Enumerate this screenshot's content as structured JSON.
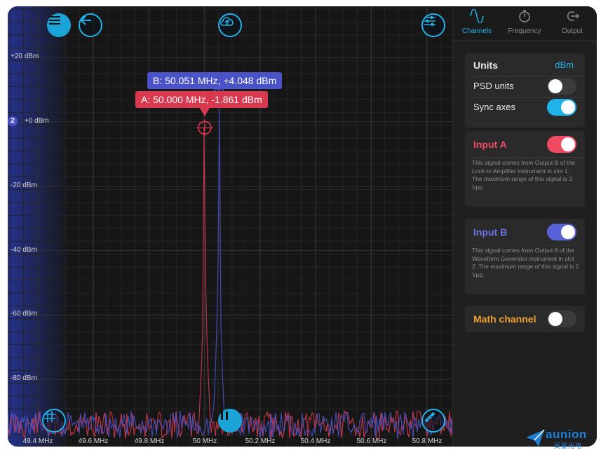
{
  "toolbar": {
    "menu_icon": "menu-icon",
    "back_icon": "arrow-left-icon",
    "upload_icon": "cloud-upload-icon",
    "settings_icon": "sliders-icon",
    "grid_icon": "grid-icon",
    "pause_icon": "pause-icon",
    "ruler_icon": "ruler-icon"
  },
  "markers": {
    "a": "A: 50.000 MHz, -1.861 dBm",
    "b": "B: 50.051 MHz, +4.048 dBm"
  },
  "channel_badge": "2",
  "colors": {
    "accent": "#1fb3ea",
    "channel_a": "#d9394f",
    "channel_b": "#4a54c8",
    "math": "#f0a030"
  },
  "chart_data": {
    "type": "line",
    "ylabel_unit": "dBm",
    "y_ticks": [
      "+20 dBm",
      "+0 dBm",
      "-20 dBm",
      "-40 dBm",
      "-60 dBm",
      "-80 dBm"
    ],
    "y_tick_values": [
      20,
      0,
      -20,
      -40,
      -60,
      -80
    ],
    "ylim": [
      -100,
      28
    ],
    "x_ticks": [
      "49.4 MHz",
      "49.6 MHz",
      "49.8 MHz",
      "50 MHz",
      "50.2 MHz",
      "50.4 MHz",
      "50.6 MHz",
      "50.8 MHz"
    ],
    "x_tick_values": [
      49.4,
      49.6,
      49.8,
      50.0,
      50.2,
      50.4,
      50.6,
      50.8
    ],
    "xlim": [
      49.25,
      50.95
    ],
    "grid": true,
    "series": [
      {
        "name": "Input A",
        "peak_x": 50.0,
        "peak_y": -1.861,
        "noise_floor": -92
      },
      {
        "name": "Input B",
        "peak_x": 50.051,
        "peak_y": 4.048,
        "noise_floor": -92
      }
    ]
  },
  "panel": {
    "tabs": [
      {
        "label": "Channels",
        "icon": "sine-wave-icon",
        "active": true
      },
      {
        "label": "Frequency",
        "icon": "stopwatch-icon",
        "active": false
      },
      {
        "label": "Output",
        "icon": "output-icon",
        "active": false
      }
    ],
    "units_label": "Units",
    "units_value": "dBm",
    "psd_label": "PSD units",
    "psd_on": false,
    "sync_label": "Sync axes",
    "sync_on": true,
    "input_a_label": "Input A",
    "input_a_on": true,
    "input_a_desc": "This signal comes from Output B of the Lock-In Amplifier instrument in slot 1. The maximum range of this signal is 2 Vpp.",
    "input_b_label": "Input B",
    "input_b_on": true,
    "input_b_desc": "This signal comes from Output A of the Waveform Generator instrument in slot 2. The maximum range of this signal is 2 Vpp.",
    "math_label": "Math channel",
    "math_on": false
  },
  "brand": {
    "name": "aunion",
    "sub": "昊量光电"
  }
}
